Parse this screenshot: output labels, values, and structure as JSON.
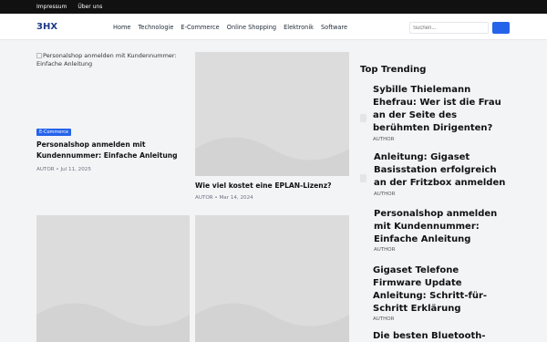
{
  "topbar": {
    "links": [
      "Impressum",
      "Über uns"
    ]
  },
  "header": {
    "logo": "3HX",
    "nav": [
      "Home",
      "Technologie",
      "E-Commerce",
      "Online Shopping",
      "Elektronik",
      "Software"
    ],
    "search_placeholder": "Suchen..."
  },
  "posts": [
    {
      "image_alt": "Personalshop anmelden mit Kundennummer: Einfache Anleitung",
      "category": "E-Commerce",
      "title": "Personalshop anmelden mit Kundennummer: Einfache Anleitung",
      "meta": "AUTOR • Jul 11, 2025"
    },
    {
      "title": "Wie viel kostet eine EPLAN-Lizenz?",
      "meta": "AUTOR • Mar 14, 2024"
    }
  ],
  "trending": {
    "heading": "Top Trending",
    "items": [
      {
        "title": "Sybille Thielemann Ehefrau: Wer ist die Frau an der Seite des berühmten Dirigenten?",
        "author": "AUTHOR"
      },
      {
        "title": "Anleitung: Gigaset Basisstation erfolgreich an der Fritzbox anmelden",
        "author": "AUTHOR"
      },
      {
        "title": "Personalshop anmelden mit Kundennummer: Einfache Anleitung",
        "author": "AUTHOR"
      },
      {
        "title": "Gigaset Telefone Firmware Update Anleitung: Schritt-für-Schritt Erklärung",
        "author": "AUTHOR"
      },
      {
        "title": "Die besten Bluetooth-",
        "author": ""
      }
    ]
  },
  "colors": {
    "accent": "#2563eb",
    "topbar": "#111111",
    "logo": "#1e3a8a"
  }
}
